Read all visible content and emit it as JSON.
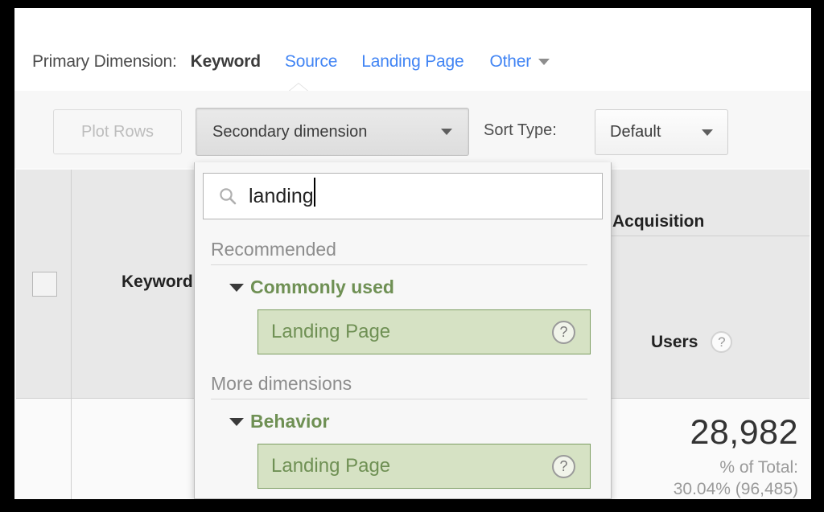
{
  "primary_dimension": {
    "label": "Primary Dimension:",
    "active": "Keyword",
    "links": [
      "Source",
      "Landing Page"
    ],
    "other": "Other",
    "other_caret_icon": "chevron-down-icon"
  },
  "toolbar": {
    "plot_rows_label": "Plot Rows",
    "secondary_dimension_label": "Secondary dimension",
    "secondary_caret_icon": "chevron-down-icon",
    "sort_type_label": "Sort Type:",
    "sort_type_value": "Default",
    "sort_caret_icon": "chevron-down-icon"
  },
  "dropdown": {
    "search_icon": "search-icon",
    "search_value": "landing",
    "search_placeholder": "",
    "sections": [
      {
        "title": "Recommended",
        "group_label": "Commonly used",
        "group_caret_icon": "triangle-down-icon",
        "item_label": "Landing Page",
        "item_help_icon": "help-icon",
        "item_help_glyph": "?"
      },
      {
        "title": "More dimensions",
        "group_label": "Behavior",
        "group_caret_icon": "triangle-down-icon",
        "item_label": "Landing Page",
        "item_help_icon": "help-icon",
        "item_help_glyph": "?"
      }
    ]
  },
  "table": {
    "column_group": "Acquisition",
    "columns": {
      "keyword": "Keyword",
      "users": "Users",
      "users_help_glyph": "?"
    },
    "rows": [
      {
        "users_value": "28,982",
        "users_pct_label": "% of Total:",
        "users_pct_value": "30.04% (96,485)"
      }
    ]
  },
  "colors": {
    "link_blue": "#4285f4",
    "green_text": "#6f9054",
    "green_fill": "#d6e2c4",
    "green_border": "#7d9e62"
  }
}
